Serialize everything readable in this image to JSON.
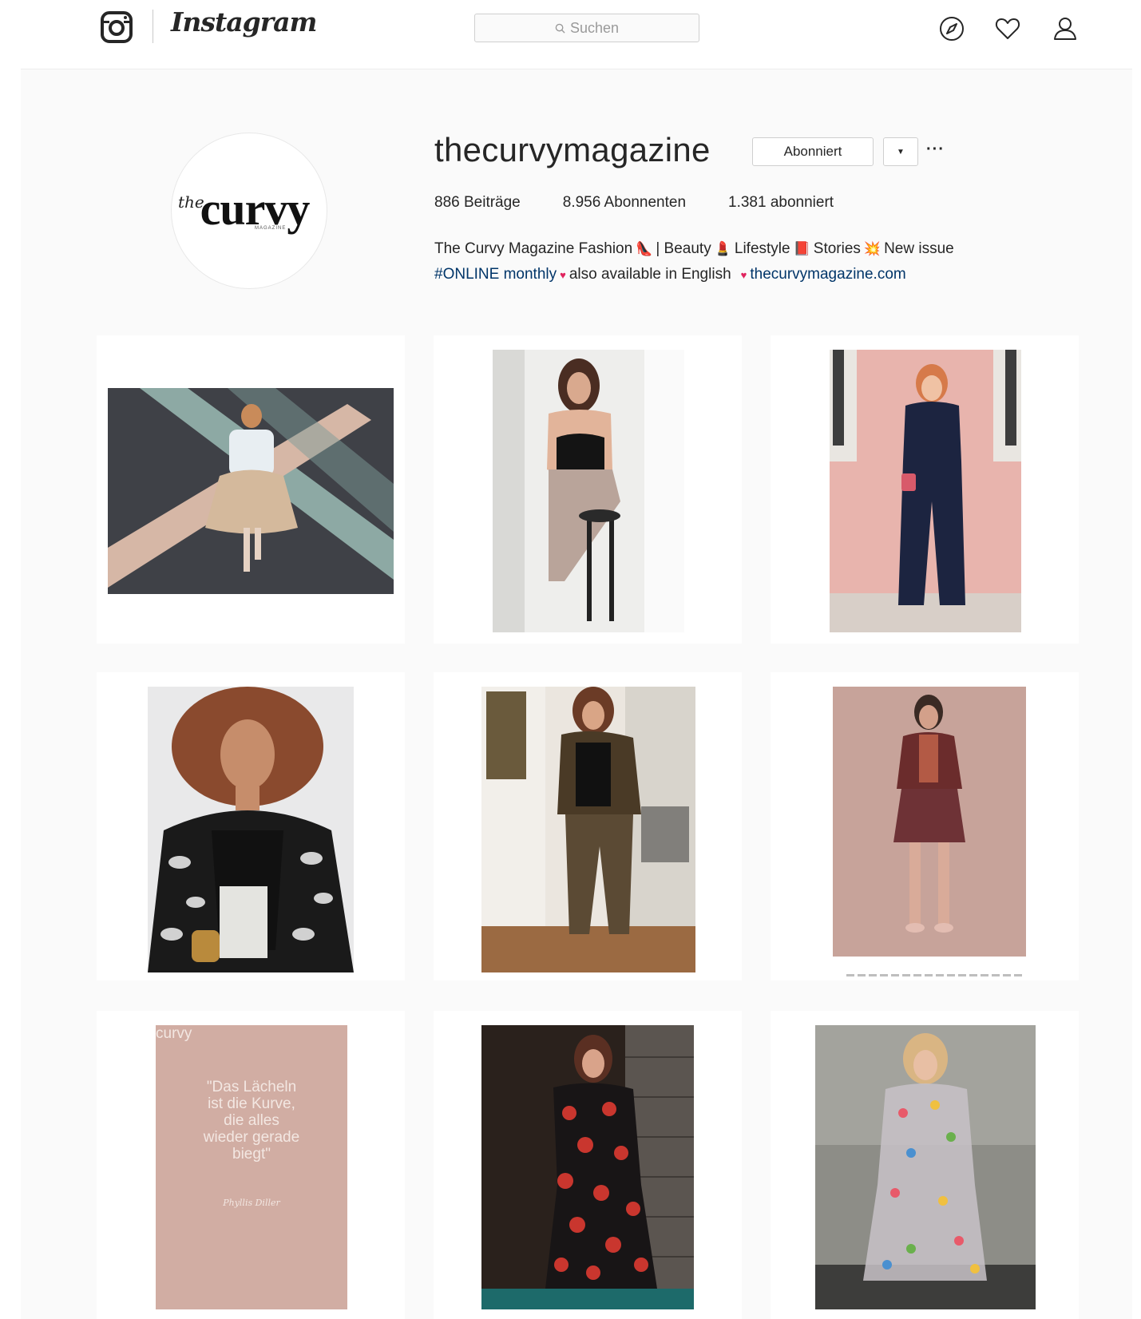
{
  "nav": {
    "brand": "Instagram",
    "search_placeholder": "Suchen",
    "icons": [
      "instagram-logo-icon",
      "explore-icon",
      "heart-icon",
      "user-icon"
    ]
  },
  "profile": {
    "username": "thecurvymagazine",
    "follow_button": "Abonniert",
    "more": "···",
    "avatar_text": {
      "prefix": "the",
      "main": "curvy",
      "sub": "MAGAZINE"
    },
    "stats": {
      "posts": "886 Beiträge",
      "followers": "8.956 Abonnenten",
      "following": "1.381 abonniert"
    },
    "bio": {
      "line1_a": "The Curvy Magazine Fashion",
      "line1_b": "| Beauty",
      "line1_c": "Lifestyle",
      "line1_d": "Stories",
      "line1_e": "New issue",
      "line2_a": "#ONLINE monthly",
      "line2_b": "also available in English",
      "link": "thecurvymagazine.com"
    }
  },
  "posts": [
    {
      "id": "post-1",
      "alt": "woman in white blouse and beige skirt in front of crossed beams"
    },
    {
      "id": "post-2",
      "alt": "woman in black lingerie seated on a stool"
    },
    {
      "id": "post-3",
      "alt": "woman in navy jumpsuit before a pink wall"
    },
    {
      "id": "post-4",
      "alt": "woman with curly hair in black and white kimono"
    },
    {
      "id": "post-5",
      "alt": "woman in leopard print suit by a window"
    },
    {
      "id": "post-6",
      "alt": "woman in burgundy leather jacket and skirt"
    },
    {
      "id": "post-7",
      "alt": "quote card",
      "quote": [
        "\"Das Lächeln",
        "ist die Kurve,",
        "die alles",
        "wieder gerade",
        "biegt\""
      ],
      "signature": "Phyllis Diller",
      "brand": "curvy"
    },
    {
      "id": "post-8",
      "alt": "woman in floral wrap dress in a doorway"
    },
    {
      "id": "post-9",
      "alt": "woman in embroidered sheer dress"
    }
  ],
  "colors": {
    "text": "#262626",
    "link": "#003569",
    "page_bg": "#fafafa",
    "border": "#cfcfcf",
    "quote_bg": "#d1ada3"
  }
}
